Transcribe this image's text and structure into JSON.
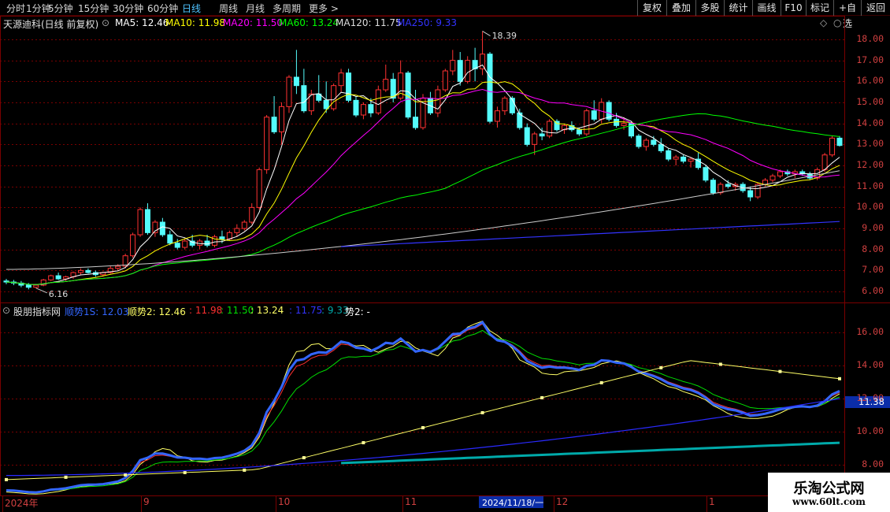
{
  "toolbar": {
    "periods": [
      "分时",
      "1分钟",
      "5分钟",
      "15分钟",
      "30分钟",
      "60分钟",
      "日线",
      "周线",
      "月线",
      "多周期",
      "更多 >"
    ],
    "active_period": "日线",
    "buttons": [
      "复权",
      "叠加",
      "多股",
      "统计",
      "画线",
      "F10",
      "标记",
      "+自选",
      "返回"
    ]
  },
  "main_legend": {
    "title": "天源迪科(日线 前复权)",
    "ma": [
      {
        "label": "MA5: 12.46",
        "color": "#ffffff"
      },
      {
        "label": "MA10: 11.98",
        "color": "#ffff00"
      },
      {
        "label": "MA20: 11.50",
        "color": "#ff00ff"
      },
      {
        "label": "MA60: 13.24",
        "color": "#00ff00"
      },
      {
        "label": "MA120: 11.75",
        "color": "#dddddd"
      },
      {
        "label": "MA250: 9.33",
        "color": "#3333ff"
      }
    ]
  },
  "sub_legend": {
    "title": "股朋指标网",
    "items": [
      {
        "label": "顺势1S: 12.03",
        "color": "#3366ff"
      },
      {
        "label": "顺势2: 12.46",
        "color": "#ffff66"
      },
      {
        "label": ": 11.98",
        "color": "#ff3030"
      },
      {
        "label": ": 11.50",
        "color": "#00dd00"
      },
      {
        "label": ": 13.24",
        "color": "#ffff66"
      },
      {
        "label": ": 11.75",
        "color": "#3333ff"
      },
      {
        "label": ": 9.33",
        "color": "#00aaaa"
      },
      {
        "label": "势2: -",
        "color": "#ffffff"
      }
    ]
  },
  "price_axis": [
    "18.00",
    "17.00",
    "16.00",
    "15.00",
    "14.00",
    "13.00",
    "12.00",
    "11.00",
    "10.00",
    "9.00",
    "8.00",
    "7.00",
    "6.00"
  ],
  "indicator_axis": [
    "16.00",
    "14.00",
    "12.00",
    "10.00",
    "8.00"
  ],
  "current_value": "11.38",
  "annotations": {
    "high": "18.39",
    "low": "6.16"
  },
  "date_axis": [
    "2024年",
    "9",
    "10",
    "11",
    "12",
    "1"
  ],
  "cursor_date": "2024/11/18/一",
  "watermark": {
    "title": "乐淘公式网",
    "url": "www.60lt.com"
  },
  "colors": {
    "up": "#ff3232",
    "down": "#54fcfc",
    "grid": "#7a0000"
  },
  "chart_data": {
    "type": "candlestick",
    "title": "天源迪科(日线 前复权)",
    "ohlc": [
      [
        6.5,
        6.6,
        6.35,
        6.45
      ],
      [
        6.45,
        6.55,
        6.3,
        6.4
      ],
      [
        6.4,
        6.5,
        6.2,
        6.3
      ],
      [
        6.3,
        6.4,
        6.1,
        6.2
      ],
      [
        6.2,
        6.35,
        6.16,
        6.3
      ],
      [
        6.3,
        6.6,
        6.25,
        6.55
      ],
      [
        6.55,
        6.8,
        6.5,
        6.75
      ],
      [
        6.75,
        6.9,
        6.55,
        6.6
      ],
      [
        6.6,
        6.75,
        6.5,
        6.7
      ],
      [
        6.7,
        6.95,
        6.6,
        6.9
      ],
      [
        6.9,
        7.1,
        6.8,
        7.0
      ],
      [
        7.0,
        7.1,
        6.85,
        6.9
      ],
      [
        6.9,
        7.0,
        6.7,
        6.8
      ],
      [
        6.8,
        6.95,
        6.7,
        6.9
      ],
      [
        6.9,
        7.2,
        6.85,
        7.1
      ],
      [
        7.1,
        7.3,
        7.0,
        7.2
      ],
      [
        7.2,
        7.8,
        7.1,
        7.7
      ],
      [
        7.7,
        8.8,
        7.6,
        8.7
      ],
      [
        8.7,
        10.0,
        8.6,
        9.9
      ],
      [
        9.9,
        10.2,
        8.7,
        8.8
      ],
      [
        8.8,
        9.4,
        8.6,
        9.3
      ],
      [
        9.3,
        9.5,
        8.6,
        8.7
      ],
      [
        8.7,
        8.9,
        8.2,
        8.3
      ],
      [
        8.3,
        8.5,
        8.0,
        8.1
      ],
      [
        8.1,
        8.5,
        8.0,
        8.4
      ],
      [
        8.4,
        8.7,
        8.1,
        8.2
      ],
      [
        8.2,
        8.5,
        8.0,
        8.4
      ],
      [
        8.4,
        8.7,
        8.1,
        8.2
      ],
      [
        8.2,
        8.7,
        8.1,
        8.6
      ],
      [
        8.6,
        8.9,
        8.3,
        8.5
      ],
      [
        8.5,
        8.9,
        8.4,
        8.8
      ],
      [
        8.8,
        9.2,
        8.6,
        9.0
      ],
      [
        9.0,
        9.4,
        8.9,
        9.3
      ],
      [
        9.3,
        10.2,
        9.2,
        10.0
      ],
      [
        10.0,
        11.9,
        9.9,
        11.8
      ],
      [
        11.8,
        14.4,
        11.6,
        14.3
      ],
      [
        14.3,
        15.3,
        13.5,
        13.6
      ],
      [
        13.6,
        15.0,
        13.0,
        14.8
      ],
      [
        14.8,
        16.3,
        14.5,
        16.2
      ],
      [
        16.2,
        17.5,
        15.4,
        15.8
      ],
      [
        15.8,
        16.6,
        14.5,
        14.6
      ],
      [
        14.6,
        15.6,
        14.4,
        15.4
      ],
      [
        15.4,
        16.3,
        15.0,
        15.1
      ],
      [
        15.1,
        16.0,
        14.5,
        14.7
      ],
      [
        14.7,
        15.9,
        14.6,
        15.8
      ],
      [
        15.8,
        16.6,
        15.5,
        16.4
      ],
      [
        16.4,
        16.6,
        15.0,
        15.1
      ],
      [
        15.1,
        15.3,
        14.3,
        14.4
      ],
      [
        14.4,
        15.0,
        14.2,
        14.9
      ],
      [
        14.9,
        15.2,
        14.3,
        14.5
      ],
      [
        14.5,
        15.8,
        14.4,
        15.6
      ],
      [
        15.6,
        16.8,
        15.5,
        16.1
      ],
      [
        16.1,
        16.4,
        15.0,
        15.2
      ],
      [
        15.2,
        17.0,
        15.1,
        16.4
      ],
      [
        16.4,
        16.5,
        14.2,
        14.3
      ],
      [
        14.3,
        15.6,
        13.7,
        13.8
      ],
      [
        13.8,
        15.4,
        13.7,
        15.2
      ],
      [
        15.2,
        15.5,
        14.4,
        14.5
      ],
      [
        14.5,
        15.8,
        14.3,
        15.6
      ],
      [
        15.6,
        16.6,
        15.5,
        16.5
      ],
      [
        16.5,
        17.5,
        16.3,
        17.0
      ],
      [
        17.0,
        17.4,
        15.8,
        16.0
      ],
      [
        16.0,
        17.2,
        15.9,
        17.0
      ],
      [
        17.0,
        17.6,
        16.0,
        16.6
      ],
      [
        16.6,
        18.39,
        16.3,
        17.3
      ],
      [
        17.3,
        17.4,
        14.0,
        14.1
      ],
      [
        14.1,
        14.8,
        13.8,
        14.6
      ],
      [
        14.6,
        15.3,
        14.4,
        15.2
      ],
      [
        15.2,
        15.3,
        14.4,
        14.5
      ],
      [
        14.5,
        14.7,
        13.7,
        13.8
      ],
      [
        13.8,
        14.0,
        12.9,
        13.0
      ],
      [
        13.0,
        13.6,
        12.5,
        13.5
      ],
      [
        13.5,
        13.8,
        13.2,
        13.4
      ],
      [
        13.4,
        14.2,
        13.3,
        14.1
      ],
      [
        14.1,
        14.2,
        13.6,
        13.7
      ],
      [
        13.7,
        14.0,
        13.5,
        13.9
      ],
      [
        13.9,
        14.1,
        13.6,
        13.7
      ],
      [
        13.7,
        13.8,
        13.4,
        13.5
      ],
      [
        13.5,
        14.7,
        13.4,
        14.6
      ],
      [
        14.6,
        15.1,
        14.1,
        14.2
      ],
      [
        14.2,
        15.2,
        14.0,
        15.0
      ],
      [
        15.0,
        15.1,
        14.1,
        14.2
      ],
      [
        14.2,
        14.5,
        13.8,
        13.9
      ],
      [
        13.9,
        14.3,
        13.7,
        14.0
      ],
      [
        14.0,
        14.1,
        13.3,
        13.4
      ],
      [
        13.4,
        13.5,
        12.8,
        12.9
      ],
      [
        12.9,
        13.3,
        12.7,
        13.2
      ],
      [
        13.2,
        13.4,
        12.9,
        13.0
      ],
      [
        13.0,
        13.3,
        12.6,
        12.7
      ],
      [
        12.7,
        12.8,
        12.2,
        12.3
      ],
      [
        12.3,
        12.5,
        12.0,
        12.4
      ],
      [
        12.4,
        12.5,
        12.1,
        12.2
      ],
      [
        12.2,
        12.4,
        11.9,
        12.3
      ],
      [
        12.3,
        12.6,
        11.8,
        11.9
      ],
      [
        11.9,
        12.0,
        11.2,
        11.3
      ],
      [
        11.3,
        11.4,
        10.6,
        10.7
      ],
      [
        10.7,
        11.2,
        10.6,
        11.1
      ],
      [
        11.1,
        11.3,
        10.9,
        11.0
      ],
      [
        11.0,
        11.2,
        10.8,
        11.1
      ],
      [
        11.1,
        11.2,
        10.7,
        10.8
      ],
      [
        10.8,
        11.0,
        10.3,
        10.5
      ],
      [
        10.5,
        11.2,
        10.4,
        11.1
      ],
      [
        11.1,
        11.4,
        11.0,
        11.3
      ],
      [
        11.3,
        11.6,
        11.2,
        11.5
      ],
      [
        11.5,
        11.8,
        11.4,
        11.7
      ],
      [
        11.7,
        11.8,
        11.5,
        11.6
      ],
      [
        11.6,
        11.8,
        11.4,
        11.7
      ],
      [
        11.7,
        11.8,
        11.5,
        11.6
      ],
      [
        11.6,
        11.7,
        11.3,
        11.4
      ],
      [
        11.4,
        11.9,
        11.3,
        11.8
      ],
      [
        11.8,
        12.6,
        11.7,
        12.5
      ],
      [
        12.5,
        13.4,
        12.4,
        13.3
      ],
      [
        13.3,
        13.4,
        12.9,
        12.95
      ]
    ]
  }
}
